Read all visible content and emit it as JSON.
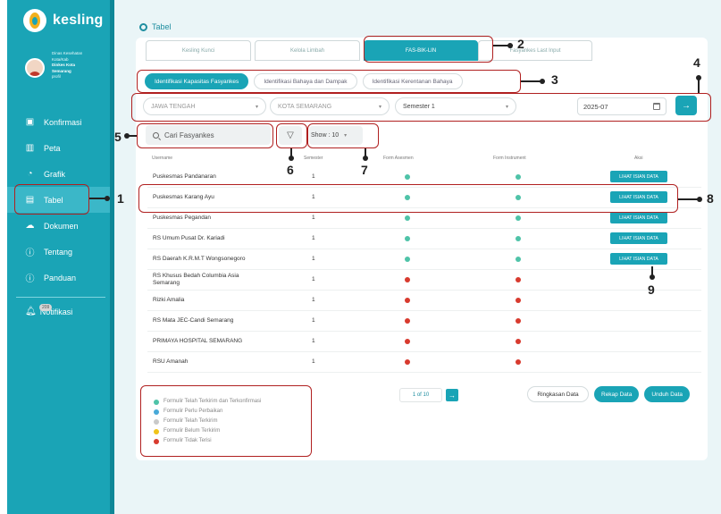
{
  "app": {
    "name": "kesling"
  },
  "profile": {
    "line1": "Dinas Kesehatan",
    "line2": "Kota/Kab",
    "line3": "Dinkes Kota",
    "line4": "Semarang",
    "line5": "profil"
  },
  "sidebar": {
    "items": [
      {
        "label": "Konfirmasi",
        "icon": "file-check-icon"
      },
      {
        "label": "Peta",
        "icon": "map-icon"
      },
      {
        "label": "Grafik",
        "icon": "chart-icon"
      },
      {
        "label": "Tabel",
        "icon": "table-icon"
      },
      {
        "label": "Dokumen",
        "icon": "cloud-icon"
      },
      {
        "label": "Tentang",
        "icon": "info-icon"
      },
      {
        "label": "Panduan",
        "icon": "info-icon"
      }
    ],
    "notif_label": "Notifikasi",
    "notif_count": "209"
  },
  "breadcrumb": "Tabel",
  "tabs": [
    "Kesling Kunci",
    "Kelola Limbah",
    "FAS-BIK-LIN",
    "Fasyankes Last Input"
  ],
  "subtabs": [
    "Identifikasi Kapasitas Fasyankes",
    "Identifikasi Bahaya dan Dampak",
    "Identifikasi Kerentanan Bahaya"
  ],
  "filters": {
    "province": "JAWA TENGAH",
    "city": "KOTA SEMARANG",
    "semester": "Semester 1",
    "date": "2025-07"
  },
  "search": {
    "placeholder": "Cari Fasyankes"
  },
  "show": "Show : 10",
  "table": {
    "headers": [
      "Username",
      "Semester",
      "Form Asesmen",
      "Form Instrument",
      "Aksi"
    ],
    "rows": [
      {
        "name": "Puskesmas Pandanaran",
        "sem": "1",
        "asesmen": "#4fc3a8",
        "instrument": "#4fc3a8",
        "action": "LIHAT ISIAN DATA"
      },
      {
        "name": "Puskesmas Karang Ayu",
        "sem": "1",
        "asesmen": "#4fc3a8",
        "instrument": "#4fc3a8",
        "action": "LIHAT ISIAN DATA"
      },
      {
        "name": "Puskesmas Pegandan",
        "sem": "1",
        "asesmen": "#4fc3a8",
        "instrument": "#4fc3a8",
        "action": "LIHAT ISIAN DATA"
      },
      {
        "name": "RS Umum Pusat Dr. Kariadi",
        "sem": "1",
        "asesmen": "#4fc3a8",
        "instrument": "#4fc3a8",
        "action": "LIHAT ISIAN DATA"
      },
      {
        "name": "RS Daerah K.R.M.T Wongsonegoro",
        "sem": "1",
        "asesmen": "#4fc3a8",
        "instrument": "#4fc3a8",
        "action": "LIHAT ISIAN DATA"
      },
      {
        "name": "RS Khusus Bedah Columbia Asia Semarang",
        "sem": "1",
        "asesmen": "#d83a2e",
        "instrument": "#d83a2e",
        "action": ""
      },
      {
        "name": "Rizki Amalia",
        "sem": "1",
        "asesmen": "#d83a2e",
        "instrument": "#d83a2e",
        "action": ""
      },
      {
        "name": "RS Mata JEC-Candi Semarang",
        "sem": "1",
        "asesmen": "#d83a2e",
        "instrument": "#d83a2e",
        "action": ""
      },
      {
        "name": "PRIMAYA HOSPITAL SEMARANG",
        "sem": "1",
        "asesmen": "#d83a2e",
        "instrument": "#d83a2e",
        "action": ""
      },
      {
        "name": "RSU Amanah",
        "sem": "1",
        "asesmen": "#d83a2e",
        "instrument": "#d83a2e",
        "action": ""
      }
    ]
  },
  "legend": [
    {
      "label": "Formulir Telah Terkirim dan Terkonfirmasi",
      "color": "#4fc3a8"
    },
    {
      "label": "Formulir Perlu Perbaikan",
      "color": "#48a9d8"
    },
    {
      "label": "Formulir Telah Terkirim",
      "color": "#c9c9c9"
    },
    {
      "label": "Formulir Belum Terkirim",
      "color": "#f0c419"
    },
    {
      "label": "Formulir Tidak Terisi",
      "color": "#d83a2e"
    }
  ],
  "pager": {
    "label": "1 of 10"
  },
  "actions": [
    "Ringkasan Data",
    "Rekap Data",
    "Unduh Data"
  ],
  "annotations": [
    "1",
    "2",
    "3",
    "4",
    "5",
    "6",
    "7",
    "8",
    "9"
  ]
}
